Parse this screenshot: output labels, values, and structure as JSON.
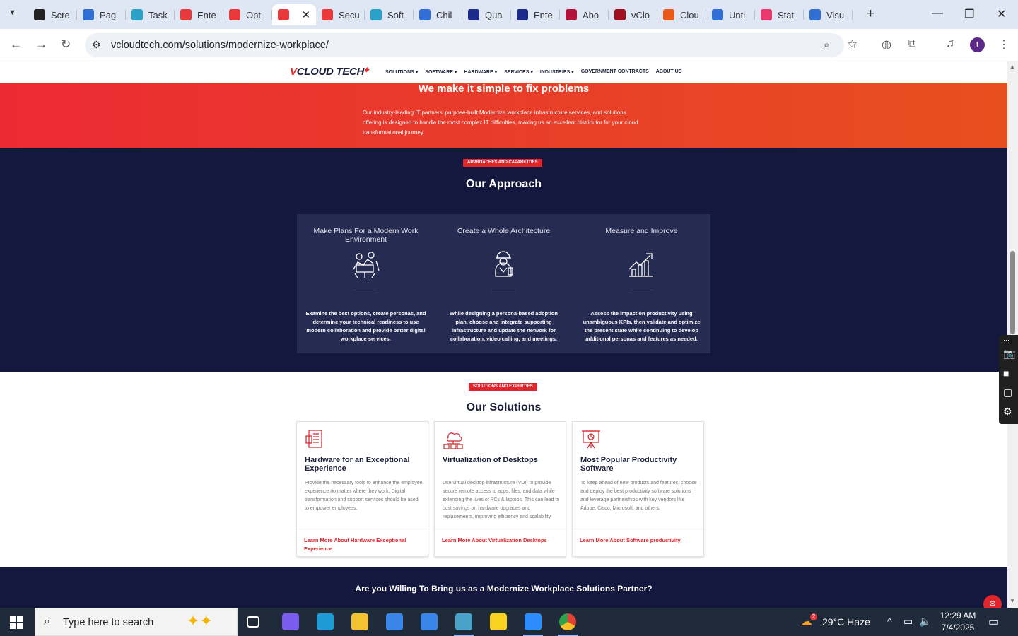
{
  "browser": {
    "tabs": [
      {
        "label": "Scre",
        "color": "#222222"
      },
      {
        "label": "Pag",
        "color": "#2f6fd6"
      },
      {
        "label": "Task",
        "color": "#2aa1c9"
      },
      {
        "label": "Ente",
        "color": "#e83a3a"
      },
      {
        "label": "Opt",
        "color": "#e83a3a"
      },
      {
        "label": "",
        "color": "#e83a3a"
      },
      {
        "label": "Secu",
        "color": "#e83a3a"
      },
      {
        "label": "Soft",
        "color": "#2aa1c9"
      },
      {
        "label": "Chil",
        "color": "#2f6fd6"
      },
      {
        "label": "Qua",
        "color": "#1c2a8c"
      },
      {
        "label": "Ente",
        "color": "#1c2a8c"
      },
      {
        "label": "Abo",
        "color": "#b0123a"
      },
      {
        "label": "vClo",
        "color": "#9c1020"
      },
      {
        "label": "Clou",
        "color": "#e85a1a"
      },
      {
        "label": "Unti",
        "color": "#2f6fd6"
      },
      {
        "label": "Stat",
        "color": "#e83a70"
      },
      {
        "label": "Visu",
        "color": "#2f6fd6"
      }
    ],
    "url": "vcloudtech.com/solutions/modernize-workplace/",
    "profile_initial": "t"
  },
  "site": {
    "logo_prefix": "V",
    "logo_rest": "CLOUD TECH",
    "nav": [
      "SOLUTIONS ▾",
      "SOFTWARE ▾",
      "HARDWARE ▾",
      "SERVICES ▾",
      "INDUSTRIES ▾",
      "GOVERNMENT CONTRACTS",
      "ABOUT US"
    ]
  },
  "hero": {
    "title": "We make it simple to fix problems",
    "text": "Our industry-leading IT partners' purpose-built Modernize workplace infrastructure services, and solutions offering is designed to handle the most complex IT difficulties, making us an excellent distributor for your cloud transformational journey."
  },
  "approach": {
    "pill": "APPROACHES AND CAPABILITIES",
    "title": "Our Approach",
    "columns": [
      {
        "title": "Make Plans For a Modern Work Environment",
        "icon": "team-meeting-icon",
        "text": "Examine the best options, create personas, and determine your technical readiness to use modern collaboration and provide better digital workplace services."
      },
      {
        "title": "Create a Whole Architecture",
        "icon": "engineer-icon",
        "text": "While designing a persona-based adoption plan, choose and integrate supporting infrastructure and update the network for collaboration, video calling, and meetings."
      },
      {
        "title": "Measure and Improve",
        "icon": "growth-chart-icon",
        "text": "Assess the impact on productivity using unambiguous KPIs, then validate and optimize the present state while continuing to develop additional personas and features as needed."
      }
    ]
  },
  "solutions": {
    "pill": "SOLUTIONS AND EXPERTIES",
    "title": "Our Solutions",
    "cards": [
      {
        "title": "Hardware for an Exceptional Experience",
        "icon": "document-icon",
        "text": "Provide the necessary tools to enhance the employee experience no matter where they work. Digital transformation and support services should be used to empower employees.",
        "link": "Learn More About Hardware Exceptional Experience"
      },
      {
        "title": "Virtualization of Desktops",
        "icon": "cloud-network-icon",
        "text": "Use virtual desktop infrastructure (VDI) to provide secure remote access to apps, files, and data while extending the lives of PCs & laptops. This can lead to cost savings on hardware upgrades and replacements, improving efficiency and scalability.",
        "link": "Learn More About Virtualization Desktops"
      },
      {
        "title": "Most Popular Productivity Software",
        "icon": "presentation-icon",
        "text": "To keep ahead of new products and features, choose and deploy the best productivity software solutions and leverage partnerships with key vendors like Adobe, Cisco, Microsoft, and others.",
        "link": "Learn More About Software productivity"
      }
    ]
  },
  "cta": {
    "text": "Are you Willing To Bring us as a Modernize Workplace Solutions Partner?"
  },
  "taskbar": {
    "search_placeholder": "Type here to search",
    "weather": "29°C  Haze",
    "weather_badge": "2",
    "time": "12:29 AM",
    "date": "7/4/2025",
    "apps": [
      {
        "name": "task-view",
        "color": "#ffffff"
      },
      {
        "name": "copilot",
        "color": "#7b5cf0"
      },
      {
        "name": "edge",
        "color": "#1e9ad6"
      },
      {
        "name": "file-explorer",
        "color": "#f3c233"
      },
      {
        "name": "store",
        "color": "#3a86e8"
      },
      {
        "name": "mail",
        "color": "#3a86e8"
      },
      {
        "name": "app-teal",
        "color": "#4aa3c6"
      },
      {
        "name": "sticky-notes",
        "color": "#f7d21e"
      },
      {
        "name": "zoom",
        "color": "#2d8cff"
      },
      {
        "name": "chrome",
        "color": "#e34133"
      }
    ]
  }
}
